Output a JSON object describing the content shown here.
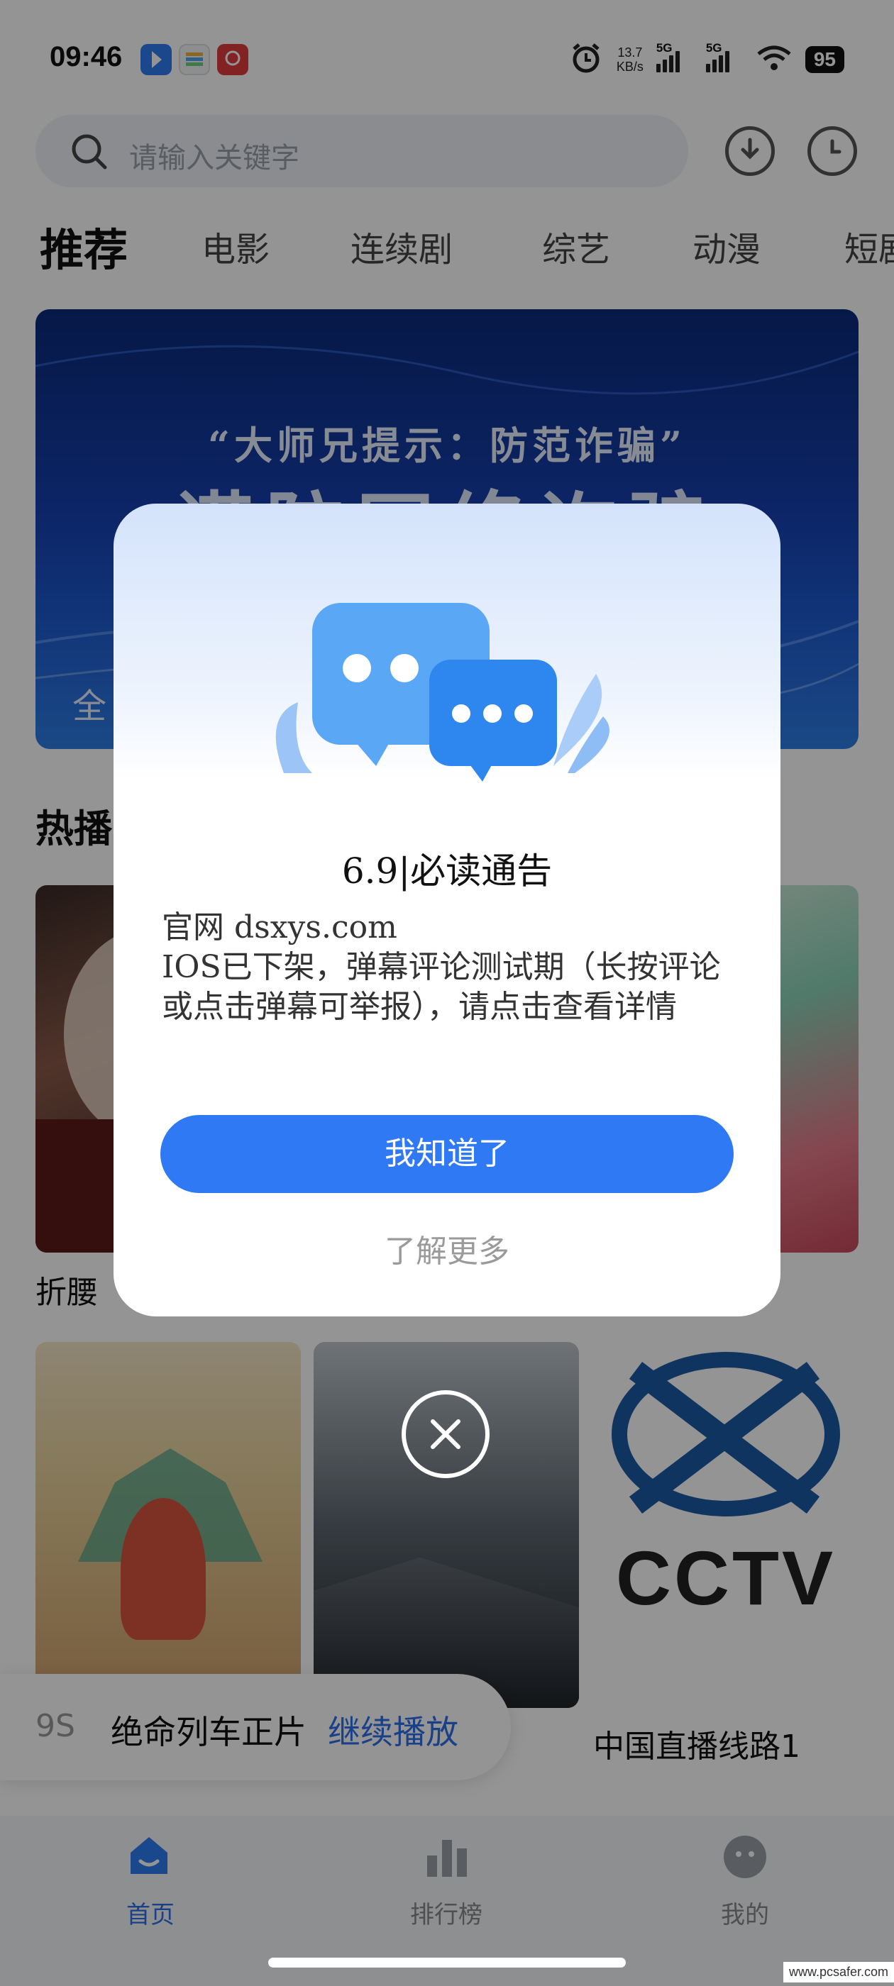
{
  "status_bar": {
    "time": "09:46",
    "net_speed_value": "13.7",
    "net_speed_unit": "KB/s",
    "signal1_label": "5G",
    "signal2_label": "5G",
    "battery": "95"
  },
  "search": {
    "placeholder": "请输入关键字"
  },
  "tabs": [
    {
      "label": "推荐"
    },
    {
      "label": "电影"
    },
    {
      "label": "连续剧"
    },
    {
      "label": "综艺"
    },
    {
      "label": "动漫"
    },
    {
      "label": "短剧"
    }
  ],
  "banner": {
    "subtitle": "“大师兄提示：防范诈骗”",
    "headline": "谨防网络诈骗",
    "bottom_text": "全"
  },
  "section": {
    "title": "热播"
  },
  "cards": [
    {
      "title": "折腰"
    },
    {
      "title": ""
    },
    {
      "title": ""
    },
    {
      "title": ""
    },
    {
      "title": "中国直播线路1",
      "logo_top": "XTV",
      "logo_bottom": "CCTV"
    }
  ],
  "continue_bar": {
    "prefix": "9S",
    "title": "绝命列车正片",
    "action": "继续播放"
  },
  "bottom_nav": [
    {
      "label": "首页",
      "icon": "home-icon",
      "active": true
    },
    {
      "label": "排行榜",
      "icon": "ranking-icon",
      "active": false
    },
    {
      "label": "我的",
      "icon": "profile-icon",
      "active": false
    }
  ],
  "dialog": {
    "title": "6.9|必读通告",
    "body_line1": "官网 dsxys.com",
    "body_line2": "IOS已下架，弹幕评论测试期（长按评论或点击弹幕可举报），请点击查看详情",
    "primary_button": "我知道了",
    "secondary_link": "了解更多"
  },
  "watermark": "www.pcsafer.com",
  "colors": {
    "accent": "#3079f5",
    "overlay": "rgba(0,0,0,0.42)"
  }
}
